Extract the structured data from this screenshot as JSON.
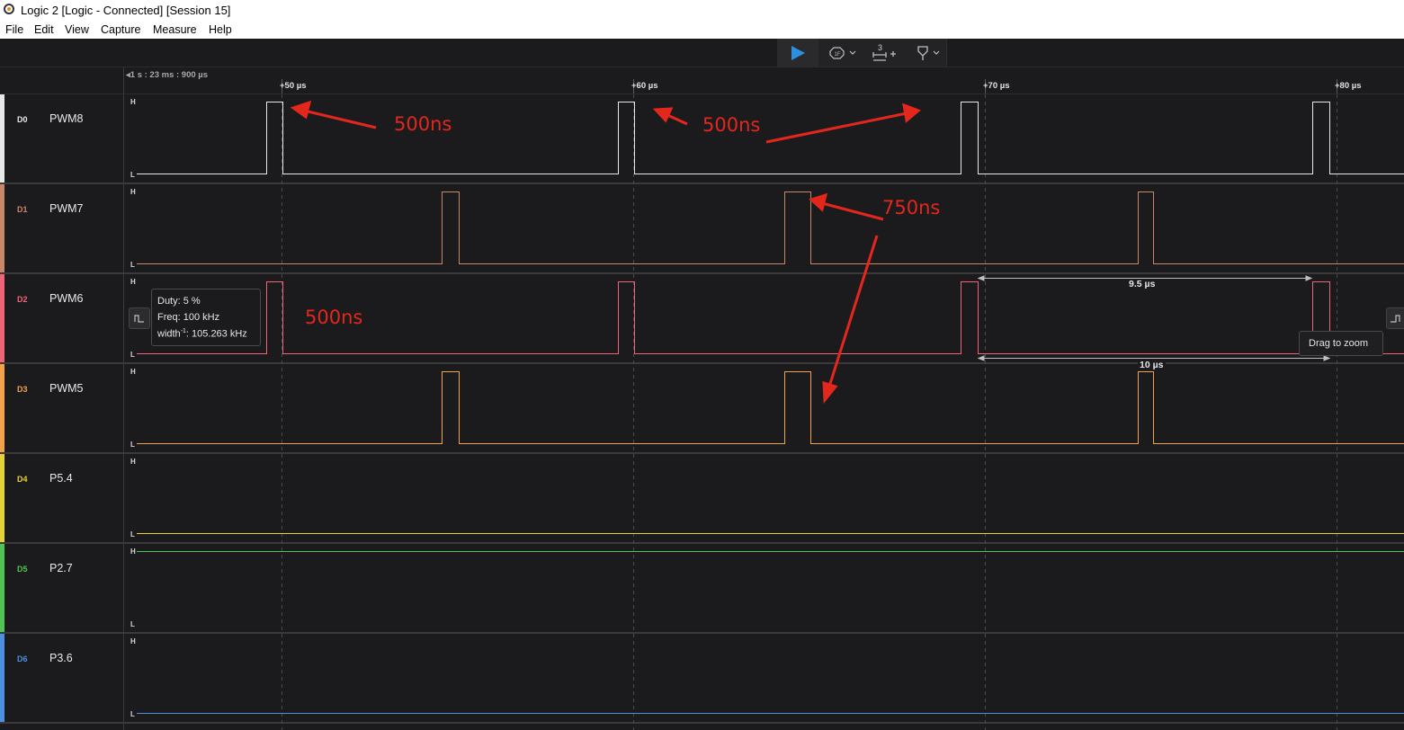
{
  "window": {
    "title": "Logic 2 [Logic - Connected] [Session 15]"
  },
  "menu": [
    "File",
    "Edit",
    "View",
    "Capture",
    "Measure",
    "Help"
  ],
  "toolbar": {
    "play_icon": "play-icon",
    "trigger_icon": "trigger-icon",
    "measure_badge": "3",
    "marker_icon": "marker-icon"
  },
  "timeline": {
    "origin": "1 s : 23 ms : 900 µs",
    "ticks": [
      "+50 µs",
      "+60 µs",
      "+70 µs",
      "+80 µs"
    ]
  },
  "levels": {
    "high": "H",
    "low": "L"
  },
  "channels": [
    {
      "id": "D0",
      "name": "PWM8",
      "color": "#e8e8ea"
    },
    {
      "id": "D1",
      "name": "PWM7",
      "color": "#c9876a"
    },
    {
      "id": "D2",
      "name": "PWM6",
      "color": "#f06478"
    },
    {
      "id": "D3",
      "name": "PWM5",
      "color": "#f4a24a"
    },
    {
      "id": "D4",
      "name": "P5.4",
      "color": "#e6d234"
    },
    {
      "id": "D5",
      "name": "P2.7",
      "color": "#4fc452"
    },
    {
      "id": "D6",
      "name": "P3.6",
      "color": "#4d8fe0"
    }
  ],
  "measurement": {
    "duty": "Duty: 5 %",
    "freq": "Freq: 100 kHz",
    "width_prefix": "width",
    "width_sup": "-1",
    "width_value": ": 105.263 kHz",
    "span_top": "9.5 µs",
    "span_bottom": "10 µs",
    "drag_hint": "Drag to zoom"
  },
  "annotations": [
    "500ns",
    "500ns",
    "750ns",
    "500ns"
  ],
  "colors": {
    "background": "#1b1b1d",
    "annotation": "#e3271d",
    "play": "#2d8fe0"
  }
}
